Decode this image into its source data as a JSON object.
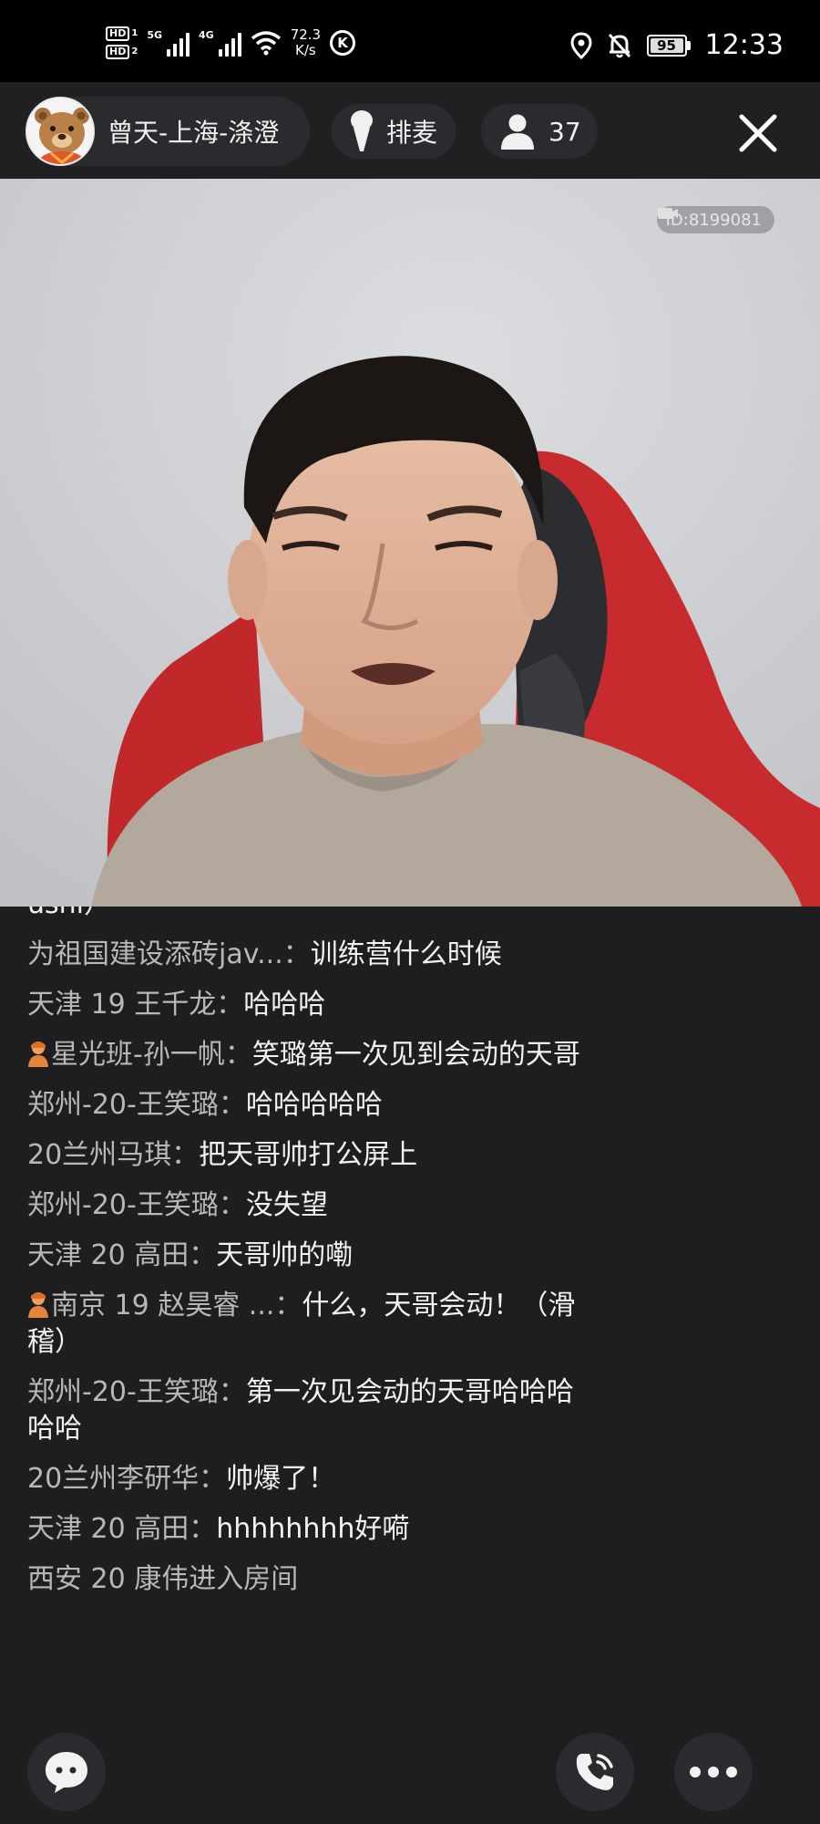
{
  "status_bar": {
    "sim1": "HD",
    "sim1_index": "1",
    "sim2": "HD",
    "sim2_index": "2",
    "network1": "5G",
    "network2": "4G",
    "speed_value": "72.3",
    "speed_unit": "K/s",
    "app_indicator": "K",
    "battery": "95",
    "time": "12:33"
  },
  "header": {
    "host_name": "曾天-上海-涤澄",
    "queue_label": "排麦",
    "audience_count": "37"
  },
  "video": {
    "room_id": "ID:8199081"
  },
  "chat": {
    "messages": [
      {
        "user": "",
        "text": "ushi）"
      },
      {
        "user": "为祖国建设添砖jav...：",
        "text": "训练营什么时候"
      },
      {
        "user": "天津  19 王千龙：",
        "text": "哈哈哈"
      },
      {
        "user": "星光班-孙一帆：",
        "text": "笑璐第一次见到会动的天哥",
        "badge": true
      },
      {
        "user": "郑州-20-王笑璐：",
        "text": "哈哈哈哈哈"
      },
      {
        "user": "20兰州马琪：",
        "text": "把天哥帅打公屏上"
      },
      {
        "user": "郑州-20-王笑璐：",
        "text": "没失望"
      },
      {
        "user": "天津 20  高田：",
        "text": "天哥帅的嘞"
      },
      {
        "user": "南京 19 赵昊睿 ...：",
        "text": "什么，天哥会动！（滑稽）",
        "badge": true
      },
      {
        "user": "郑州-20-王笑璐：",
        "text": "第一次见会动的天哥哈哈哈哈哈"
      },
      {
        "user": "20兰州李研华：",
        "text": "帅爆了！"
      },
      {
        "user": "天津 20  高田：",
        "text": "hhhhhhhh好嗬"
      }
    ],
    "notice": "西安 20 康伟进入房间"
  },
  "colors": {
    "background": "#1d1e20",
    "pill": "#2a2b2e",
    "username": "#b8b8b8",
    "message": "#f2f2f2"
  },
  "icons": [
    "bear-avatar",
    "microphone-icon",
    "person-icon",
    "close-icon",
    "camera-icon",
    "chat-bubble-icon",
    "phone-call-icon",
    "more-icon"
  ]
}
